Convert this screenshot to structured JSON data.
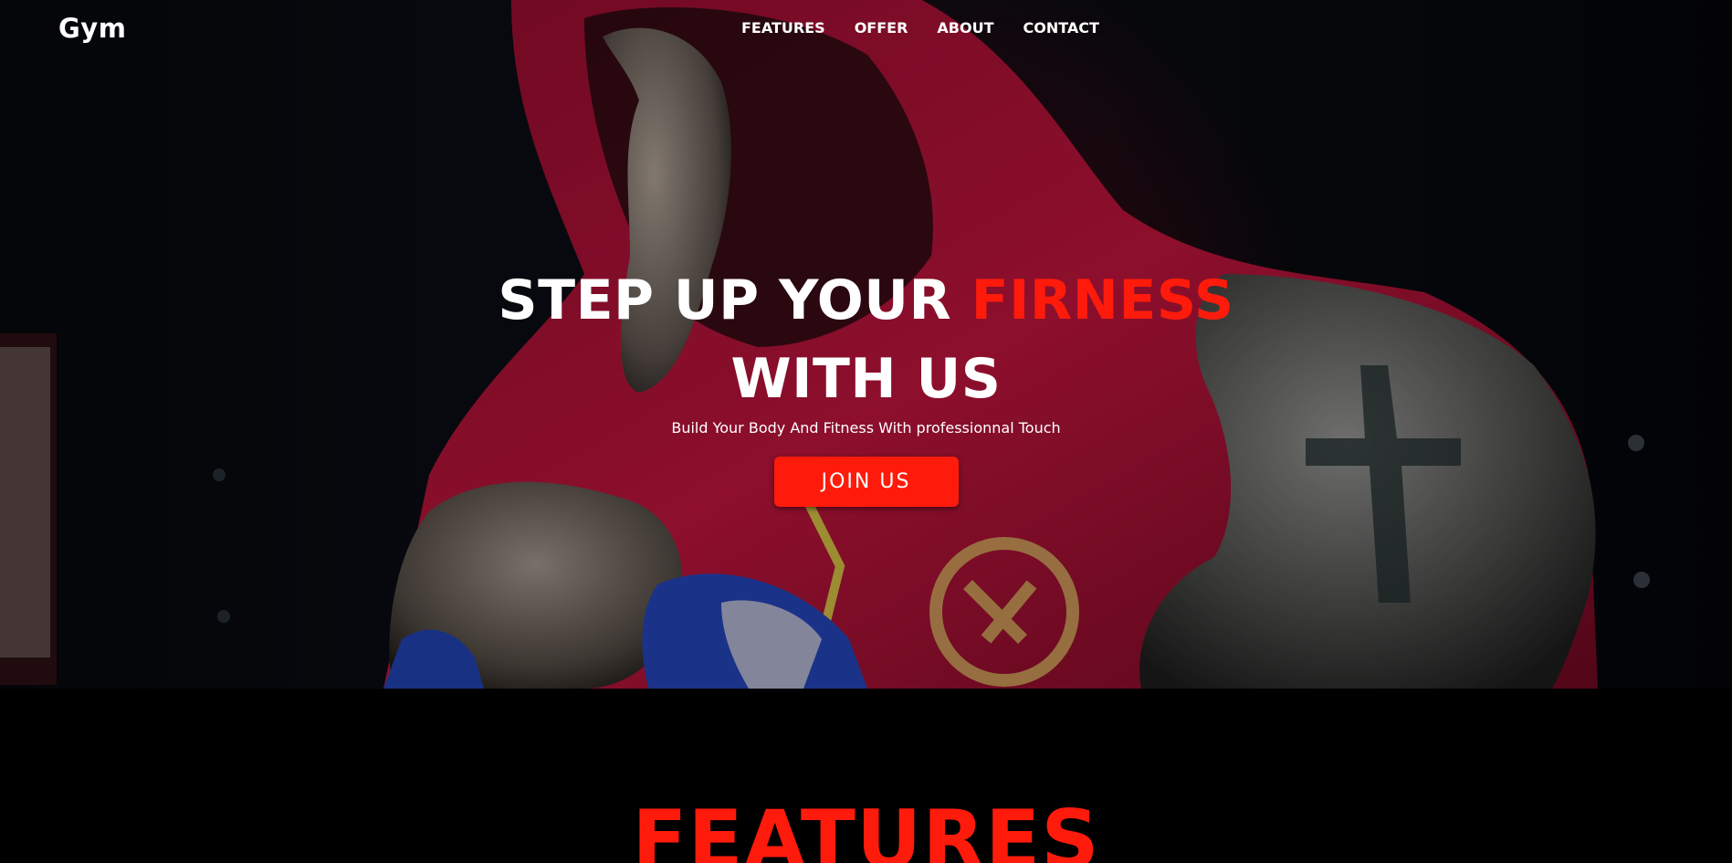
{
  "brand": {
    "name": "Gym"
  },
  "nav": {
    "items": [
      {
        "label": "FEATURES"
      },
      {
        "label": "OFFER"
      },
      {
        "label": "ABOUT"
      },
      {
        "label": "CONTACT"
      }
    ]
  },
  "hero": {
    "headline_part1": "STEP UP YOUR",
    "headline_accent": "FIRNESS",
    "headline_line2": "WITH US",
    "subtitle": "Build Your Body And Fitness With professionnal Touch",
    "cta_label": "JOIN US",
    "background_image": "boxer-in-red-hoodie"
  },
  "features": {
    "title": "FEATURES"
  },
  "colors": {
    "accent": "#ff1b0b",
    "background": "#000000",
    "text": "#ffffff"
  }
}
